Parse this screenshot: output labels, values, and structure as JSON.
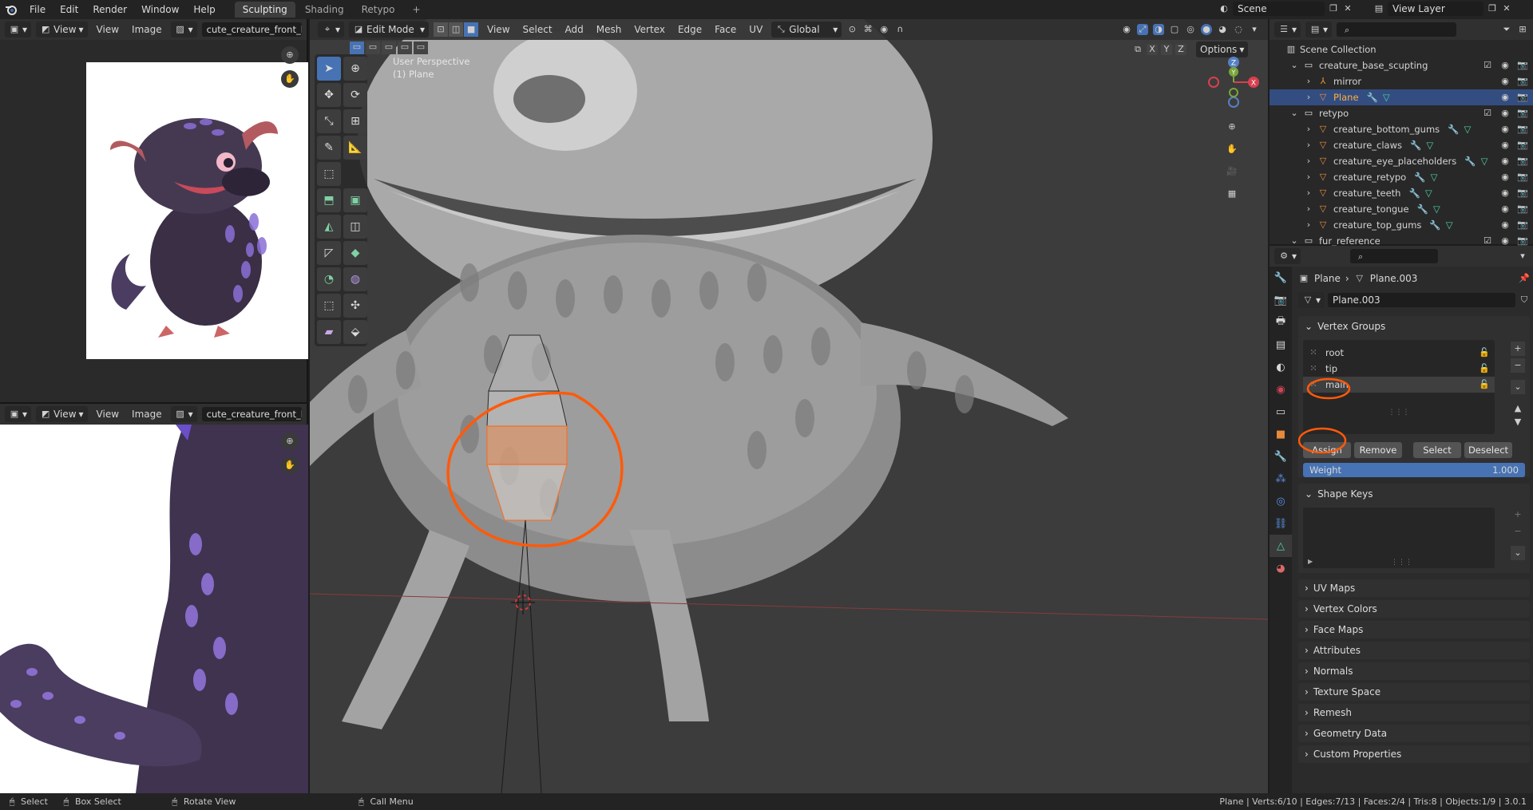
{
  "menubar": {
    "items": [
      "File",
      "Edit",
      "Render",
      "Window",
      "Help"
    ],
    "workspace_tabs": [
      "Sculpting",
      "Shading",
      "Retypo"
    ],
    "add_tab": "+",
    "scene_label": "Scene",
    "view_layer_label": "View Layer"
  },
  "image_editor_top": {
    "view_menu": "View",
    "view_btn": "View",
    "image_btn": "Image",
    "image_name": "cute_creature_front_back."
  },
  "image_editor_bottom": {
    "view_menu": "View",
    "view_btn": "View",
    "image_btn": "Image",
    "image_name": "cute_creature_front_back."
  },
  "viewport": {
    "mode": "Edit Mode",
    "menus": [
      "View",
      "Select",
      "Add",
      "Mesh",
      "Vertex",
      "Edge",
      "Face",
      "UV"
    ],
    "orientation": "Global",
    "overlay_text_1": "User Perspective",
    "overlay_text_2": "(1) Plane",
    "options_label": "Options",
    "axes": [
      "X",
      "Y",
      "Z"
    ],
    "gizmo_axes": {
      "z": "Z",
      "x": "X",
      "y": "Y"
    }
  },
  "outliner": {
    "search_placeholder": "",
    "scene_collection": "Scene Collection",
    "rows": [
      {
        "label": "creature_base_scupting",
        "indent": 1,
        "type": "collection"
      },
      {
        "label": "mirror",
        "indent": 2,
        "type": "empty"
      },
      {
        "label": "Plane",
        "indent": 2,
        "type": "mesh",
        "selected": true
      },
      {
        "label": "retypo",
        "indent": 1,
        "type": "collection"
      },
      {
        "label": "creature_bottom_gums",
        "indent": 2,
        "type": "mesh"
      },
      {
        "label": "creature_claws",
        "indent": 2,
        "type": "mesh"
      },
      {
        "label": "creature_eye_placeholders",
        "indent": 2,
        "type": "mesh"
      },
      {
        "label": "creature_retypo",
        "indent": 2,
        "type": "mesh"
      },
      {
        "label": "creature_teeth",
        "indent": 2,
        "type": "mesh"
      },
      {
        "label": "creature_tongue",
        "indent": 2,
        "type": "mesh"
      },
      {
        "label": "creature_top_gums",
        "indent": 2,
        "type": "mesh"
      },
      {
        "label": "fur_reference",
        "indent": 1,
        "type": "collection"
      }
    ]
  },
  "properties": {
    "breadcrumb_object": "Plane",
    "breadcrumb_mesh": "Plane.003",
    "mesh_datablock": "Plane.003",
    "vertex_groups_title": "Vertex Groups",
    "vertex_groups": [
      "root",
      "tip",
      "main"
    ],
    "active_group": "main",
    "buttons": {
      "assign": "Assign",
      "remove": "Remove",
      "select": "Select",
      "deselect": "Deselect"
    },
    "weight_label": "Weight",
    "weight_value": "1.000",
    "weight": 1.0,
    "shape_keys_title": "Shape Keys",
    "collapsed_panels": [
      "UV Maps",
      "Vertex Colors",
      "Face Maps",
      "Attributes",
      "Normals",
      "Texture Space",
      "Remesh",
      "Geometry Data",
      "Custom Properties"
    ]
  },
  "statusbar": {
    "select": "Select",
    "box_select": "Box Select",
    "rotate_view": "Rotate View",
    "call_menu": "Call Menu",
    "stats": "Plane | Verts:6/10 | Edges:7/13 | Faces:2/4 | Tris:8 | Objects:1/9 | 3.0.1"
  },
  "colors": {
    "accent": "#4772b3",
    "selection_orange": "#f0722b",
    "annotation_orange": "#ff5a0a"
  }
}
